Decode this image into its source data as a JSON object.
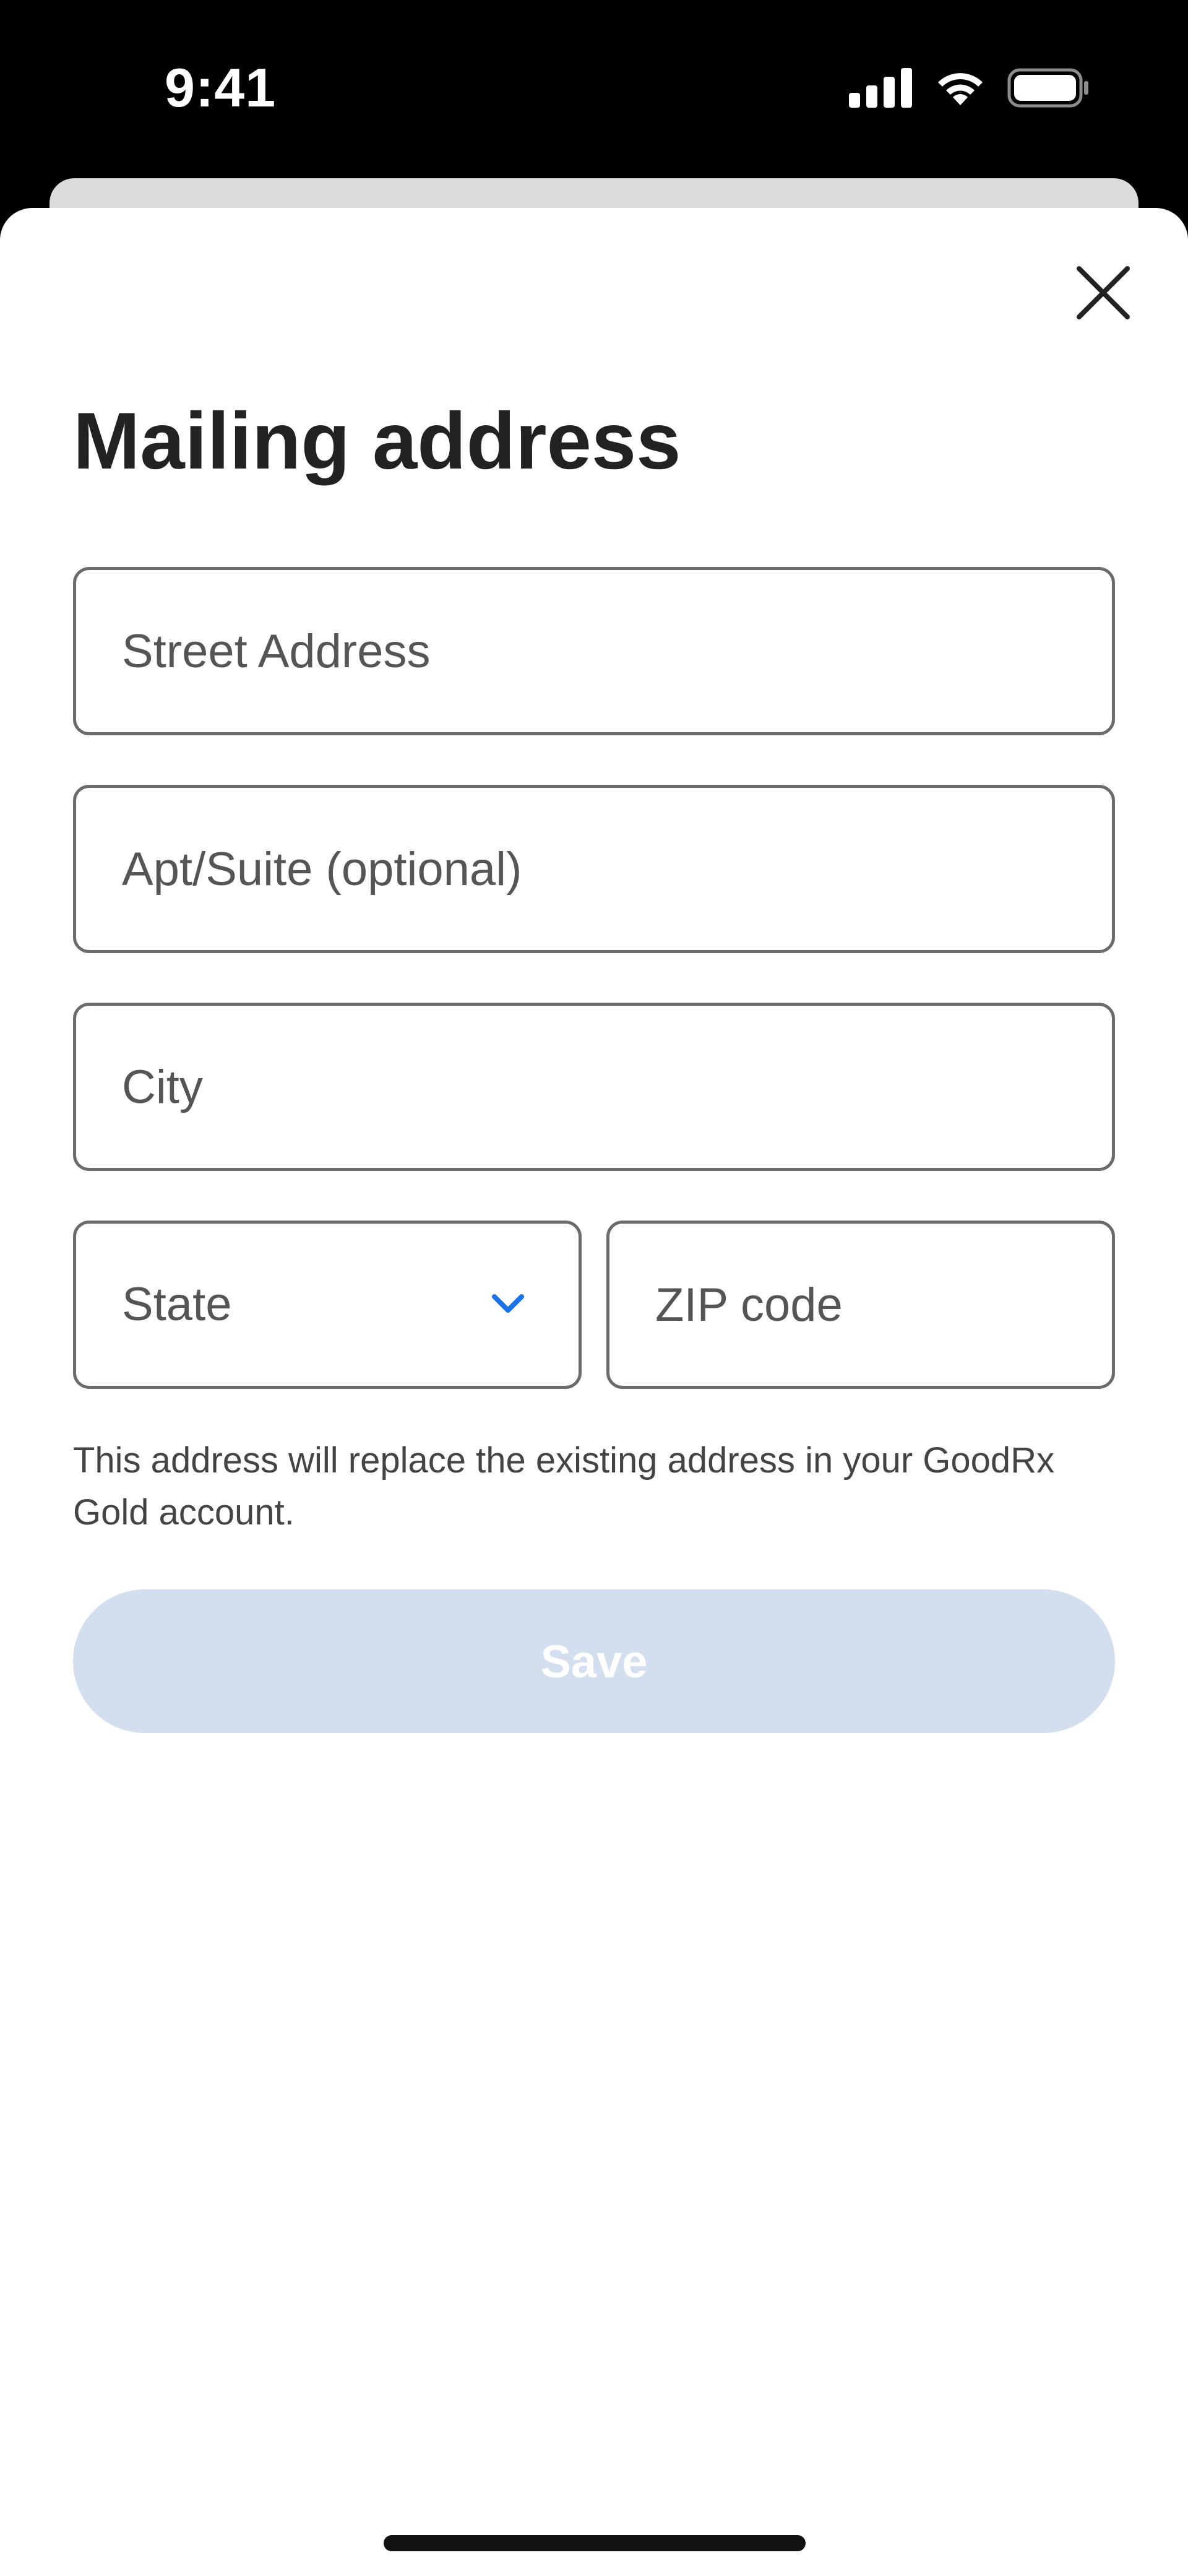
{
  "status_bar": {
    "time": "9:41",
    "icons": [
      "cellular-signal-icon",
      "wifi-icon",
      "battery-icon"
    ]
  },
  "sheet": {
    "title": "Mailing address",
    "close_icon": "close-icon"
  },
  "form": {
    "street": {
      "placeholder": "Street Address",
      "value": ""
    },
    "apt": {
      "placeholder": "Apt/Suite (optional)",
      "value": ""
    },
    "city": {
      "placeholder": "City",
      "value": ""
    },
    "state": {
      "label": "State",
      "icon": "chevron-down-icon"
    },
    "zip": {
      "placeholder": "ZIP code",
      "value": ""
    }
  },
  "info_text": "This address will replace the existing address in your GoodRx Gold account.",
  "save_label": "Save",
  "colors": {
    "background": "#000000",
    "sheet": "#ffffff",
    "field_border": "#6b6b6b",
    "accent_chevron": "#1a73e8",
    "save_disabled_bg": "#d3dfee",
    "save_text": "#ffffff"
  }
}
